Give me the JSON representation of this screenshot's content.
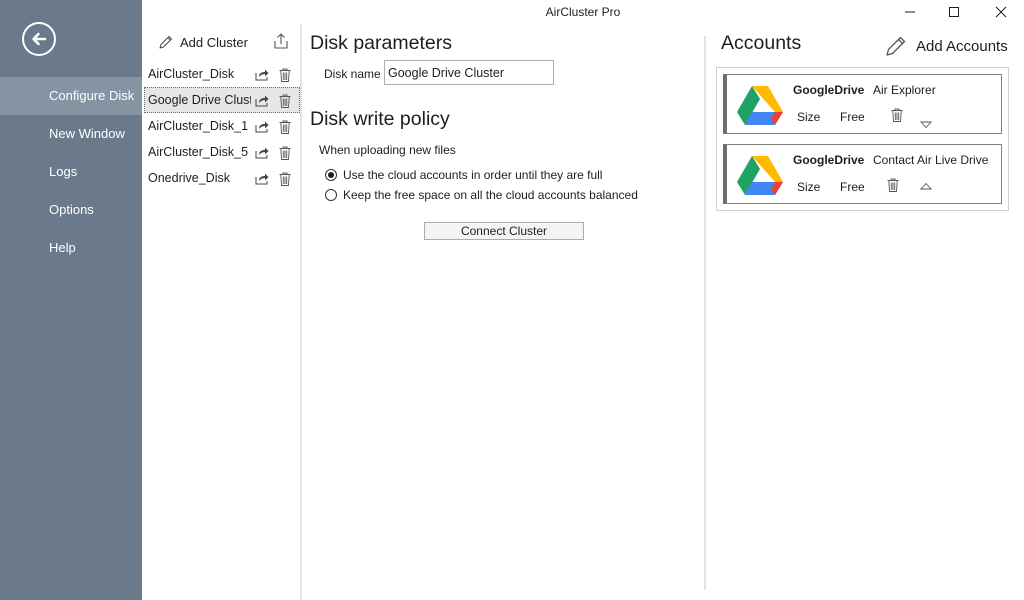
{
  "window": {
    "title": "AirCluster Pro"
  },
  "nav": {
    "items": [
      {
        "label": "Configure Disk",
        "active": true
      },
      {
        "label": "New Window",
        "active": false
      },
      {
        "label": "Logs",
        "active": false
      },
      {
        "label": "Options",
        "active": false
      },
      {
        "label": "Help",
        "active": false
      }
    ]
  },
  "clusters": {
    "add_label": "Add Cluster",
    "items": [
      {
        "name": "AirCluster_Disk",
        "selected": false
      },
      {
        "name": "Google Drive Clust",
        "selected": true
      },
      {
        "name": "AirCluster_Disk_1",
        "selected": false
      },
      {
        "name": "AirCluster_Disk_5",
        "selected": false
      },
      {
        "name": "Onedrive_Disk",
        "selected": false
      }
    ]
  },
  "params": {
    "title": "Disk parameters",
    "disk_name_label": "Disk name",
    "disk_name_value": "Google Drive Cluster",
    "write_policy_title": "Disk write policy",
    "when_uploading": "When uploading new files",
    "option_order": "Use the cloud accounts in order until they are full",
    "option_balanced": "Keep the free space on all the cloud accounts balanced",
    "selected_option": "order",
    "connect_label": "Connect Cluster"
  },
  "accounts": {
    "title": "Accounts",
    "add_label": "Add Accounts",
    "items": [
      {
        "type": "GoogleDrive",
        "name": "Air Explorer",
        "size_label": "Size",
        "free_label": "Free",
        "arrow": "down"
      },
      {
        "type": "GoogleDrive",
        "name": "Contact Air Live Drive",
        "size_label": "Size",
        "free_label": "Free",
        "arrow": "up"
      }
    ]
  },
  "colors": {
    "nav_bg": "#6b7a8b",
    "nav_active": "#8593a3",
    "gdrive_green": "#1ea362",
    "gdrive_blue": "#4285f4",
    "gdrive_yellow": "#ffba00",
    "gdrive_red": "#ea4335"
  }
}
